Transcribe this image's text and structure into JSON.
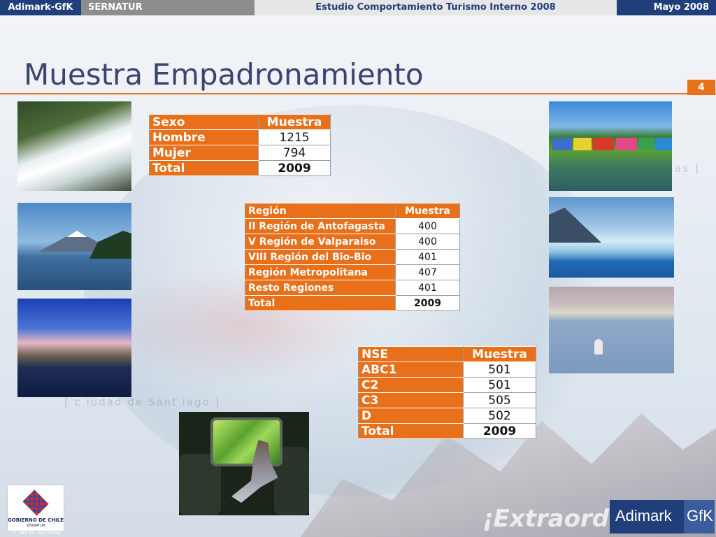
{
  "topbar": {
    "company": "Adimark-GfK",
    "client": "SERNATUR",
    "study": "Estudio Comportamiento Turismo Interno 2008",
    "date": "Mayo 2008"
  },
  "slide": {
    "title": "Muestra Empadronamiento",
    "page_number": "4"
  },
  "background_text": {
    "brand_line": "¡Extraord",
    "puro_chile": "Puro Chile",
    "caption_city": "[ c iudad de  Sant iago ]",
    "caption_right": "as ]"
  },
  "table_sexo": {
    "headers": [
      "Sexo",
      "Muestra"
    ],
    "rows": [
      {
        "label": "Hombre",
        "value": "1215"
      },
      {
        "label": "Mujer",
        "value": "794"
      }
    ],
    "total": {
      "label": "Total",
      "value": "2009"
    }
  },
  "table_region": {
    "headers": [
      "Región",
      "Muestra"
    ],
    "rows": [
      {
        "label": "II Región de Antofagasta",
        "value": "400"
      },
      {
        "label": "V Región de Valparaiso",
        "value": "400"
      },
      {
        "label": "VIII Región del Bio-Bio",
        "value": "401"
      },
      {
        "label": "Región Metropolitana",
        "value": "407"
      },
      {
        "label": "Resto Regiones",
        "value": "401"
      }
    ],
    "total": {
      "label": "Total",
      "value": "2009"
    }
  },
  "table_nse": {
    "headers": [
      "NSE",
      "Muestra"
    ],
    "rows": [
      {
        "label": "ABC1",
        "value": "501"
      },
      {
        "label": "C2",
        "value": "501"
      },
      {
        "label": "C3",
        "value": "505"
      },
      {
        "label": "D",
        "value": "502"
      }
    ],
    "total": {
      "label": "Total",
      "value": "2009"
    }
  },
  "logos": {
    "gobierno_line1": "GOBIERNO DE CHILE",
    "gobierno_line2": "SERNATUR",
    "adimark": "Adimark",
    "gfk": "GfK"
  },
  "colors": {
    "accent_orange": "#e8701a",
    "navy": "#1f3e7a",
    "title": "#3b4370"
  }
}
